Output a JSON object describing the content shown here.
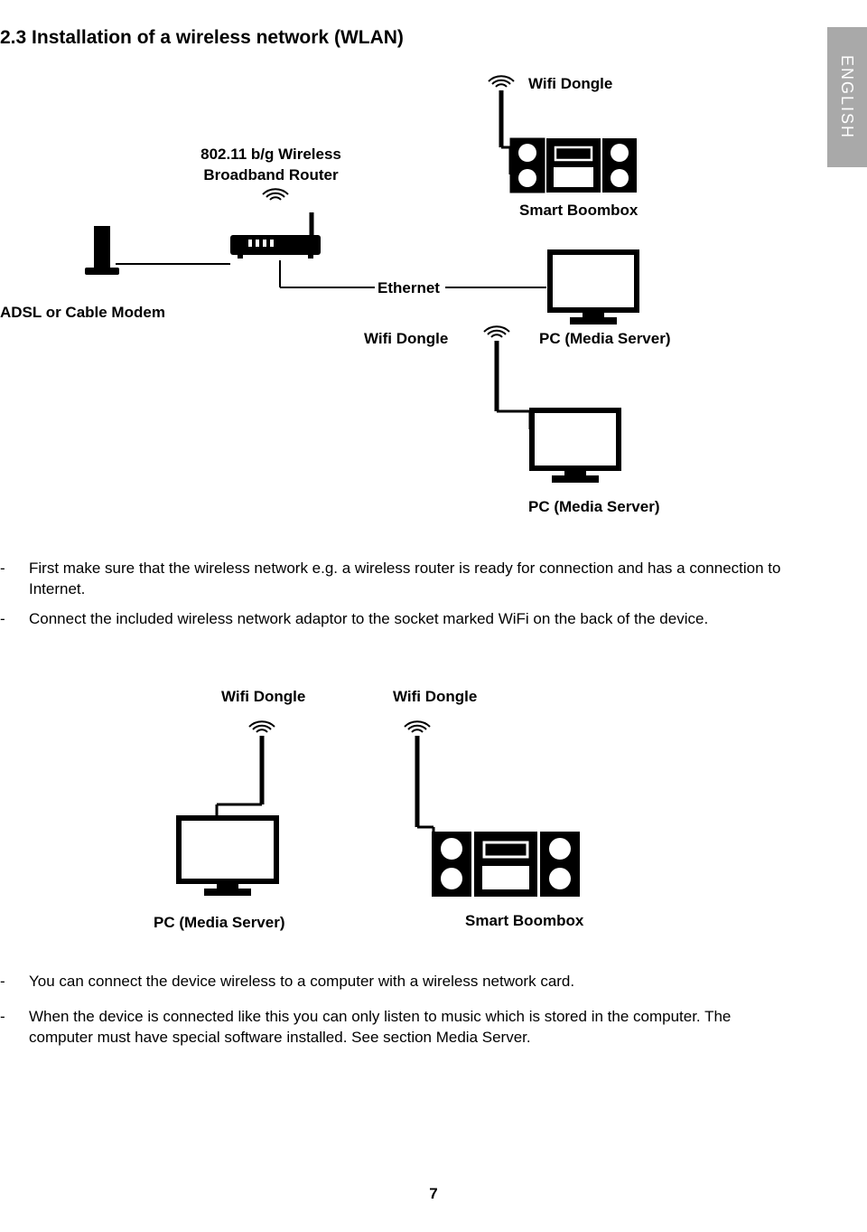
{
  "heading": "2.3 Installation of a wireless network (WLAN)",
  "sideTab": "ENGLISH",
  "diagram1": {
    "wifiDongleTop": "Wifi Dongle",
    "router": "802.11 b/g Wireless Broadband Router",
    "smartBoombox": "Smart Boombox",
    "ethernet": "Ethernet",
    "modem": "ADSL or Cable Modem",
    "wifiDongleMid": "Wifi Dongle",
    "pcMedia1": "PC (Media Server)",
    "pcMedia2": "PC (Media Server)"
  },
  "bodyA": {
    "item1": "First make sure that the wireless network e.g. a wireless router is ready for connection and has a connection to Internet.",
    "item2": "Connect the included wireless network adaptor to the socket marked WiFi on the back of the device."
  },
  "diagram2": {
    "wifiDongleL": "Wifi Dongle",
    "wifiDongleR": "Wifi Dongle",
    "pcMedia": "PC (Media Server)",
    "smartBoombox": "Smart Boombox"
  },
  "bodyB": {
    "item1": "You can connect the device wireless to a computer with a wireless network card.",
    "item2": "When the device is connected like this you can only listen to music which is stored in the computer. The computer must have special software installed. See section Media Server."
  },
  "pageNumber": "7"
}
